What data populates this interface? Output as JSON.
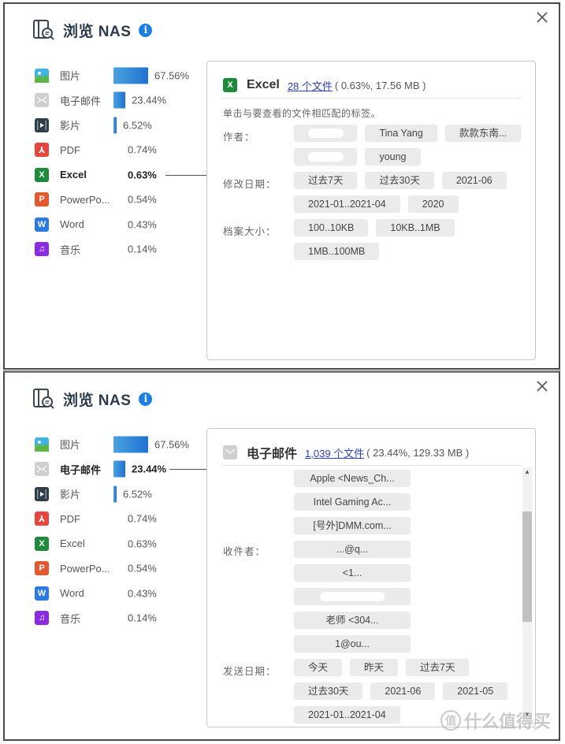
{
  "title": "浏览 NAS",
  "colors": {
    "accent": "#1a7fe8",
    "bar": "#1f72d1",
    "link": "#2b3fc7",
    "tag_bg": "#ebebeb",
    "images": "#3fb4e6",
    "email": "#cfcfcf",
    "video": "#2f3e48",
    "pdf": "#e8453c",
    "excel": "#1f8a3a",
    "powerpoint": "#e2582f",
    "word": "#2a7ae2",
    "music": "#8a2be2"
  },
  "legend": [
    {
      "key": "images",
      "icon": "image-icon",
      "label": "图片",
      "percent": "67.56%",
      "value": 67.56
    },
    {
      "key": "email",
      "icon": "email-icon",
      "label": "电子邮件",
      "percent": "23.44%",
      "value": 23.44
    },
    {
      "key": "video",
      "icon": "video-icon",
      "label": "影片",
      "percent": "6.52%",
      "value": 6.52
    },
    {
      "key": "pdf",
      "icon": "pdf-icon",
      "label": "PDF",
      "percent": "0.74%",
      "value": 0.74
    },
    {
      "key": "excel",
      "icon": "excel-icon",
      "label": "Excel",
      "percent": "0.63%",
      "value": 0.63
    },
    {
      "key": "powerpoint",
      "icon": "powerpoint-icon",
      "label": "PowerPo...",
      "percent": "0.54%",
      "value": 0.54
    },
    {
      "key": "word",
      "icon": "word-icon",
      "label": "Word",
      "percent": "0.43%",
      "value": 0.43
    },
    {
      "key": "music",
      "icon": "music-icon",
      "label": "音乐",
      "percent": "0.14%",
      "value": 0.14
    }
  ],
  "panel1": {
    "active": "excel",
    "title": "Excel",
    "files_link": "28 个文件",
    "meta": "( 0.63%, 17.56 MB )",
    "hint": "单击与要查看的文件相匹配的标签。",
    "sections": [
      {
        "label": "作者：",
        "tags": [
          {
            "text": "[已遮挡]",
            "redacted": true
          },
          {
            "text": "Tina Yang"
          },
          {
            "text": "款款东南...",
            "partial": true
          },
          {
            "text": "[已遮挡]",
            "redacted": true
          },
          {
            "text": "young"
          }
        ]
      },
      {
        "label": "修改日期：",
        "tags": [
          {
            "text": "过去7天"
          },
          {
            "text": "过去30天"
          },
          {
            "text": "2021-06"
          },
          {
            "text": "2021-01..2021-04"
          },
          {
            "text": "2020"
          }
        ]
      },
      {
        "label": "档案大小：",
        "tags": [
          {
            "text": "100..10KB"
          },
          {
            "text": "10KB..1MB"
          },
          {
            "text": "1MB..100MB"
          }
        ]
      }
    ]
  },
  "panel2": {
    "active": "email",
    "title": "电子邮件",
    "files_link": "1,039 个文件",
    "meta": "( 23.44%, 129.33 MB )",
    "sections": [
      {
        "label": "收件者：",
        "tags": [
          {
            "text": "Apple <News_Ch..."
          },
          {
            "text": "Intel Gaming Ac..."
          },
          {
            "text": "[号外]DMM.com..."
          },
          {
            "text": "...@q...",
            "partial": true
          },
          {
            "text": "<1...",
            "partial": true
          },
          {
            "text": "[已遮挡]",
            "redacted": true
          },
          {
            "text": "老师 <304...",
            "partial": true
          },
          {
            "text": "1@ou...",
            "partial": true
          }
        ]
      },
      {
        "label": "发送日期：",
        "tags": [
          {
            "text": "今天"
          },
          {
            "text": "昨天"
          },
          {
            "text": "过去7天"
          },
          {
            "text": "过去30天"
          },
          {
            "text": "2021-06"
          },
          {
            "text": "2021-05"
          },
          {
            "text": "2021-01..2021-04"
          }
        ]
      }
    ]
  },
  "watermark": {
    "circle": "值",
    "text": "什么值得买"
  }
}
